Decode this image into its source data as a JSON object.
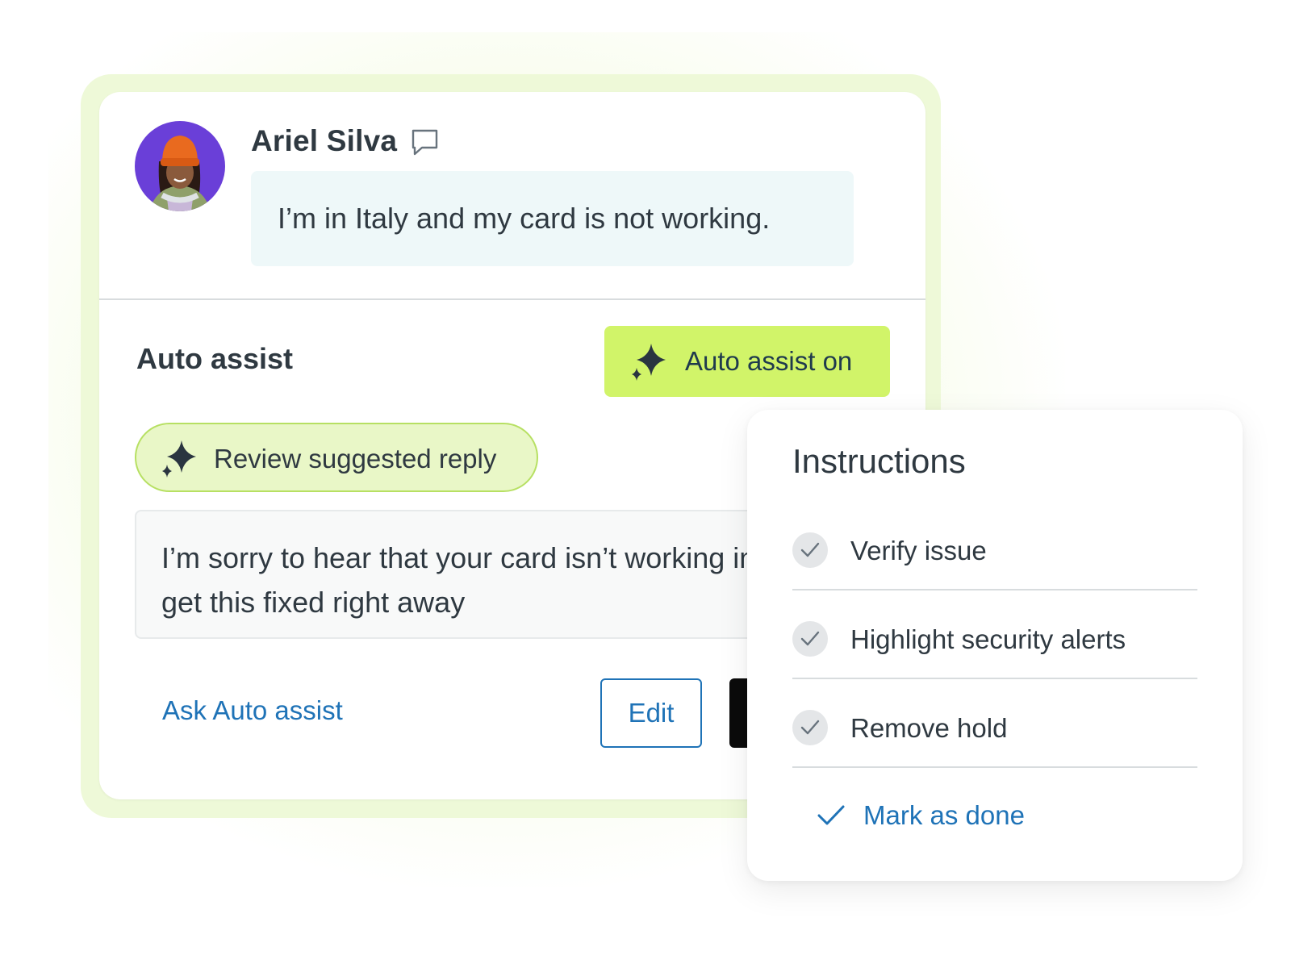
{
  "conversation": {
    "user_name": "Ariel Silva",
    "message": "I’m in Italy and my card is not working."
  },
  "auto_assist": {
    "title": "Auto assist",
    "toggle_label": "Auto assist on",
    "review_label": "Review suggested reply",
    "suggested_reply": "I’m sorry to hear that your card isn’t working in Italy. Let’s get this fixed right away",
    "ask_link": "Ask Auto assist",
    "edit_label": "Edit"
  },
  "instructions": {
    "title": "Instructions",
    "items": [
      {
        "label": "Verify issue"
      },
      {
        "label": "Highlight security alerts"
      },
      {
        "label": "Remove hold"
      }
    ],
    "mark_done_label": "Mark as done"
  },
  "colors": {
    "accent_green": "#d1f469",
    "link_blue": "#1f73b7",
    "bubble_bg": "#eef8f9",
    "avatar_bg": "#6a3fd8"
  },
  "icons": {
    "chat": "speech-bubble-icon",
    "sparkle": "sparkle-icon",
    "check": "checkmark-icon"
  }
}
